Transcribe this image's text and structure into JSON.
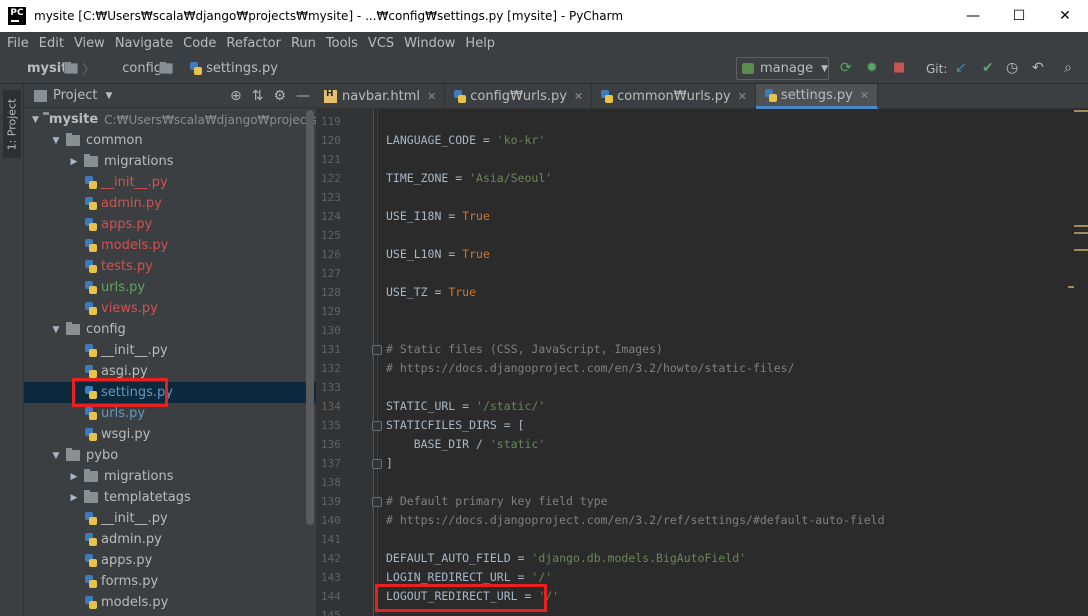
{
  "window": {
    "title": "mysite [C:₩Users₩scala₩django₩projects₩mysite] - ...₩config₩settings.py [mysite] - PyCharm",
    "app_icon": "PC",
    "minimize": "—",
    "maximize": "☐",
    "close": "✕"
  },
  "menu": [
    "File",
    "Edit",
    "View",
    "Navigate",
    "Code",
    "Refactor",
    "Run",
    "Tools",
    "VCS",
    "Window",
    "Help"
  ],
  "breadcrumb": {
    "root": "mysite",
    "folder": "config",
    "file": "settings.py"
  },
  "toolbar": {
    "run_config": "manage",
    "git_label": "Git:"
  },
  "project_panel": {
    "title": "Project",
    "side_tab": "1: Project",
    "tree": [
      {
        "label": "mysite",
        "path": "C:₩Users₩scala₩django₩projects₩mysite",
        "type": "folder",
        "depth": 0,
        "expanded": true
      },
      {
        "label": "common",
        "type": "folder",
        "depth": 1,
        "expanded": true
      },
      {
        "label": "migrations",
        "type": "folder",
        "depth": 2,
        "expanded": false
      },
      {
        "label": "__init__.py",
        "type": "py",
        "depth": 2,
        "color": "red"
      },
      {
        "label": "admin.py",
        "type": "py",
        "depth": 2,
        "color": "red"
      },
      {
        "label": "apps.py",
        "type": "py",
        "depth": 2,
        "color": "red"
      },
      {
        "label": "models.py",
        "type": "py",
        "depth": 2,
        "color": "red"
      },
      {
        "label": "tests.py",
        "type": "py",
        "depth": 2,
        "color": "red"
      },
      {
        "label": "urls.py",
        "type": "py",
        "depth": 2,
        "color": "green"
      },
      {
        "label": "views.py",
        "type": "py",
        "depth": 2,
        "color": "red"
      },
      {
        "label": "config",
        "type": "folder",
        "depth": 1,
        "expanded": true
      },
      {
        "label": "__init__.py",
        "type": "py",
        "depth": 2,
        "color": "normal"
      },
      {
        "label": "asgi.py",
        "type": "py",
        "depth": 2,
        "color": "normal"
      },
      {
        "label": "settings.py",
        "type": "py",
        "depth": 2,
        "color": "blue",
        "selected": true
      },
      {
        "label": "urls.py",
        "type": "py",
        "depth": 2,
        "color": "blue"
      },
      {
        "label": "wsgi.py",
        "type": "py",
        "depth": 2,
        "color": "normal"
      },
      {
        "label": "pybo",
        "type": "folder",
        "depth": 1,
        "expanded": true
      },
      {
        "label": "migrations",
        "type": "folder",
        "depth": 2,
        "expanded": false
      },
      {
        "label": "templatetags",
        "type": "folder",
        "depth": 2,
        "expanded": false
      },
      {
        "label": "__init__.py",
        "type": "py",
        "depth": 2,
        "color": "normal"
      },
      {
        "label": "admin.py",
        "type": "py",
        "depth": 2,
        "color": "normal"
      },
      {
        "label": "apps.py",
        "type": "py",
        "depth": 2,
        "color": "normal"
      },
      {
        "label": "forms.py",
        "type": "py",
        "depth": 2,
        "color": "normal"
      },
      {
        "label": "models.py",
        "type": "py",
        "depth": 2,
        "color": "normal"
      }
    ]
  },
  "tabs": [
    {
      "label": "navbar.html",
      "icon": "html-icon",
      "active": false
    },
    {
      "label": "config₩urls.py",
      "icon": "python-icon",
      "active": false
    },
    {
      "label": "common₩urls.py",
      "icon": "python-icon",
      "active": false
    },
    {
      "label": "settings.py",
      "icon": "python-icon",
      "active": true
    }
  ],
  "editor": {
    "lines": [
      {
        "n": "119",
        "t": ""
      },
      {
        "n": "120",
        "t": "LANGUAGE_CODE = 'ko-kr'"
      },
      {
        "n": "121",
        "t": ""
      },
      {
        "n": "122",
        "t": "TIME_ZONE = 'Asia/Seoul'"
      },
      {
        "n": "123",
        "t": ""
      },
      {
        "n": "124",
        "t": "USE_I18N = True"
      },
      {
        "n": "125",
        "t": ""
      },
      {
        "n": "126",
        "t": "USE_L10N = True"
      },
      {
        "n": "127",
        "t": ""
      },
      {
        "n": "128",
        "t": "USE_TZ = True"
      },
      {
        "n": "129",
        "t": ""
      },
      {
        "n": "130",
        "t": ""
      },
      {
        "n": "131",
        "t": "# Static files (CSS, JavaScript, Images)"
      },
      {
        "n": "132",
        "t": "# https://docs.djangoproject.com/en/3.2/howto/static-files/"
      },
      {
        "n": "133",
        "t": ""
      },
      {
        "n": "134",
        "t": "STATIC_URL = '/static/'"
      },
      {
        "n": "135",
        "t": "STATICFILES_DIRS = ["
      },
      {
        "n": "136",
        "t": "    BASE_DIR / 'static'"
      },
      {
        "n": "137",
        "t": "]"
      },
      {
        "n": "138",
        "t": ""
      },
      {
        "n": "139",
        "t": "# Default primary key field type"
      },
      {
        "n": "140",
        "t": "# https://docs.djangoproject.com/en/3.2/ref/settings/#default-auto-field"
      },
      {
        "n": "141",
        "t": ""
      },
      {
        "n": "142",
        "t": "DEFAULT_AUTO_FIELD = 'django.db.models.BigAutoField'"
      },
      {
        "n": "143",
        "t": "LOGIN_REDIRECT_URL = '/'"
      },
      {
        "n": "144",
        "t": "LOGOUT_REDIRECT_URL = '/'"
      },
      {
        "n": "145",
        "t": ""
      }
    ]
  },
  "colors": {
    "accent": "#4a88c7",
    "highlight_box": "#e8201f",
    "selection": "#0d293e"
  }
}
